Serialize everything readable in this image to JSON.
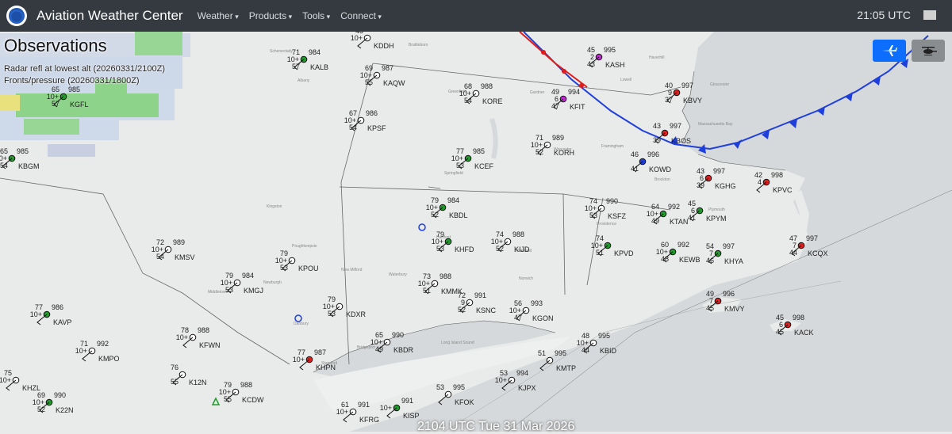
{
  "header": {
    "brand": "Aviation Weather Center",
    "menu": [
      "Weather",
      "Products",
      "Tools",
      "Connect"
    ],
    "time": "21:05 UTC"
  },
  "overlay": {
    "title": "Observations",
    "radar": "Radar refl at lowest alt (20260331/2100Z)",
    "fronts": "Fronts/pressure (20260331/1800Z)"
  },
  "timestamp": "2104 UTC Tue 31 Mar 2026",
  "colors": {
    "navbar": "#343a40",
    "accent": "#0d6efd",
    "cold_front": "#1f3fdc",
    "warm_front": "#e01b1b",
    "vfr": "#1f9a2b",
    "ifr": "#dd1f1f",
    "mvfr": "#1f3fdc",
    "lifr": "#c02bd1"
  },
  "stations": [
    {
      "id": "KDDH",
      "t": "45",
      "d": "",
      "v": "10+",
      "p": "",
      "c": "#ffffff"
    },
    {
      "id": "KALB",
      "t": "71",
      "d": "57",
      "v": "10+",
      "p": "984",
      "c": "#1f9a2b"
    },
    {
      "id": "KAQW",
      "t": "69",
      "d": "55",
      "v": "10+",
      "p": "987",
      "c": "#ffffff"
    },
    {
      "id": "KGFL",
      "t": "65",
      "d": "57",
      "v": "10+",
      "p": "985",
      "c": "#1f9a2b"
    },
    {
      "id": "KBGM",
      "t": "65",
      "d": "54",
      "v": "10+",
      "p": "985",
      "c": "#1f9a2b"
    },
    {
      "id": "KPSF",
      "t": "67",
      "d": "54",
      "v": "10+",
      "p": "986",
      "c": "#ffffff"
    },
    {
      "id": "KORE",
      "t": "68",
      "d": "54",
      "v": "10+",
      "p": "988",
      "c": "#ffffff"
    },
    {
      "id": "KFIT",
      "t": "49",
      "d": "47",
      "v": "6",
      "p": "994",
      "c": "#c02bd1"
    },
    {
      "id": "KASH",
      "t": "45",
      "d": "43",
      "v": "2",
      "p": "995",
      "c": "#c02bd1"
    },
    {
      "id": "KBVY",
      "t": "40",
      "d": "37",
      "v": "9",
      "p": "997",
      "c": "#dd1f1f"
    },
    {
      "id": "KBOS",
      "t": "43",
      "d": "39",
      "v": "",
      "p": "997",
      "c": "#dd1f1f"
    },
    {
      "id": "KORH",
      "t": "71",
      "d": "52",
      "v": "10+",
      "p": "989",
      "c": "#ffffff"
    },
    {
      "id": "KCEF",
      "t": "77",
      "d": "53",
      "v": "10+",
      "p": "985",
      "c": "#1f9a2b"
    },
    {
      "id": "KOWD",
      "t": "46",
      "d": "41",
      "v": "",
      "p": "996",
      "c": "#1f3fdc"
    },
    {
      "id": "KGHG",
      "t": "43",
      "d": "39",
      "v": "6",
      "p": "997",
      "c": "#dd1f1f"
    },
    {
      "id": "KPVC",
      "t": "42",
      "d": "",
      "v": "4",
      "p": "998",
      "c": "#dd1f1f"
    },
    {
      "id": "KBDL",
      "t": "79",
      "d": "52",
      "v": "10+",
      "p": "984",
      "c": "#1f9a2b"
    },
    {
      "id": "KSFZ",
      "t": "74",
      "d": "53",
      "v": "10+",
      "p": "990",
      "c": "#ffffff"
    },
    {
      "id": "KTAN",
      "t": "64",
      "d": "49",
      "v": "10+",
      "p": "992",
      "c": "#1f9a2b"
    },
    {
      "id": "KPYM",
      "t": "45",
      "d": "41",
      "v": "6",
      "p": "",
      "c": "#1f9a2b"
    },
    {
      "id": "KHFD",
      "t": "79",
      "d": "53",
      "v": "10+",
      "p": "",
      "c": "#1f9a2b"
    },
    {
      "id": "KIJD",
      "t": "74",
      "d": "52",
      "v": "10+",
      "p": "988",
      "c": "#ffffff"
    },
    {
      "id": "KPVD",
      "t": "74",
      "d": "51",
      "v": "10+",
      "p": "",
      "c": "#1f9a2b"
    },
    {
      "id": "KEWB",
      "t": "60",
      "d": "48",
      "v": "10+",
      "p": "992",
      "c": "#1f9a2b"
    },
    {
      "id": "KHYA",
      "t": "54",
      "d": "46",
      "v": "7",
      "p": "997",
      "c": "#1f9a2b"
    },
    {
      "id": "KCQX",
      "t": "47",
      "d": "44",
      "v": "7",
      "p": "997",
      "c": "#dd1f1f"
    },
    {
      "id": "KMSV",
      "t": "72",
      "d": "54",
      "v": "10+",
      "p": "989",
      "c": "#ffffff"
    },
    {
      "id": "KPOU",
      "t": "79",
      "d": "53",
      "v": "10+",
      "p": "",
      "c": "#ffffff"
    },
    {
      "id": "KMGJ",
      "t": "79",
      "d": "53",
      "v": "10+",
      "p": "984",
      "c": "#ffffff"
    },
    {
      "id": "KMMK",
      "t": "73",
      "d": "51",
      "v": "10+",
      "p": "988",
      "c": "#ffffff"
    },
    {
      "id": "KSNC",
      "t": "72",
      "d": "52",
      "v": "9",
      "p": "991",
      "c": "#ffffff"
    },
    {
      "id": "KGON",
      "t": "56",
      "d": "47",
      "v": "10+",
      "p": "993",
      "c": "#ffffff"
    },
    {
      "id": "KMVY",
      "t": "49",
      "d": "45",
      "v": "7",
      "p": "996",
      "c": "#dd1f1f"
    },
    {
      "id": "KACK",
      "t": "45",
      "d": "45",
      "v": "6",
      "p": "998",
      "c": "#dd1f1f"
    },
    {
      "id": "KDXR",
      "t": "79",
      "d": "53",
      "v": "10+",
      "p": "",
      "c": "#ffffff"
    },
    {
      "id": "KAVP",
      "t": "77",
      "d": "",
      "v": "10+",
      "p": "986",
      "c": "#1f9a2b"
    },
    {
      "id": "KFWN",
      "t": "78",
      "d": "",
      "v": "10+",
      "p": "988",
      "c": "#ffffff"
    },
    {
      "id": "KMPO",
      "t": "71",
      "d": "",
      "v": "10+",
      "p": "992",
      "c": "#ffffff"
    },
    {
      "id": "K12N",
      "t": "76",
      "d": "55",
      "v": "",
      "p": "",
      "c": "#ffffff"
    },
    {
      "id": "KBDR",
      "t": "65",
      "d": "49",
      "v": "10+",
      "p": "990",
      "c": "#ffffff"
    },
    {
      "id": "KBID",
      "t": "48",
      "d": "44",
      "v": "10+",
      "p": "995",
      "c": "#ffffff"
    },
    {
      "id": "KHZL",
      "t": "75",
      "d": "",
      "v": "10+",
      "p": "",
      "c": "#ffffff"
    },
    {
      "id": "KCDW",
      "t": "79",
      "d": "55",
      "v": "10+",
      "p": "988",
      "c": "#ffffff"
    },
    {
      "id": "K22N",
      "t": "69",
      "d": "52",
      "v": "10+",
      "p": "990",
      "c": "#1f9a2b"
    },
    {
      "id": "KHPN",
      "t": "77",
      "d": "",
      "v": "10+",
      "p": "987",
      "c": "#dd1f1f"
    },
    {
      "id": "KMTP",
      "t": "51",
      "d": "",
      "v": "",
      "p": "995",
      "c": "#ffffff"
    },
    {
      "id": "KJPX",
      "t": "53",
      "d": "",
      "v": "10+",
      "p": "994",
      "c": "#ffffff"
    },
    {
      "id": "KFOK",
      "t": "53",
      "d": "",
      "v": "",
      "p": "995",
      "c": "#ffffff"
    },
    {
      "id": "KISP",
      "t": "",
      "d": "",
      "v": "10+",
      "p": "991",
      "c": "#1f9a2b"
    },
    {
      "id": "KFRG",
      "t": "61",
      "d": "",
      "v": "10+",
      "p": "991",
      "c": "#ffffff"
    }
  ],
  "places": [
    "Schenectady",
    "Albany",
    "Brattleboro",
    "Greenfield",
    "Gardner",
    "Springfield",
    "Worcester",
    "Framingham",
    "Lowell",
    "Haverhill",
    "Gloucester",
    "Brockton",
    "Providence",
    "Plymouth",
    "Hartford",
    "New Milford",
    "Waterbury",
    "Norwich",
    "Poughkeepsie",
    "Newburgh",
    "Middletown",
    "Stamford",
    "Bridgeport",
    "Danbury",
    "Kingston",
    "Long Island Sound",
    "Plainfield",
    "Massachusetts Bay"
  ]
}
